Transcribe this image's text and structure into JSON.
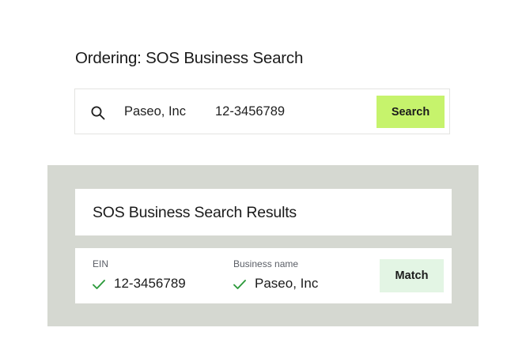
{
  "page": {
    "title": "Ordering: SOS Business Search"
  },
  "search": {
    "business_name_value": "Paseo, Inc",
    "ein_value": "12-3456789",
    "button_label": "Search",
    "icon": "search-icon"
  },
  "results": {
    "title": "SOS Business Search Results",
    "row": {
      "ein_label": "EIN",
      "ein_value": "12-3456789",
      "business_name_label": "Business name",
      "business_name_value": "Paseo, Inc",
      "status_label": "Match",
      "check_icon": "check-icon"
    }
  },
  "colors": {
    "search_button": "#c6f36c",
    "match_badge": "#e3f5e4",
    "panel_background": "#d5d8d1",
    "check": "#2e9b3d"
  }
}
